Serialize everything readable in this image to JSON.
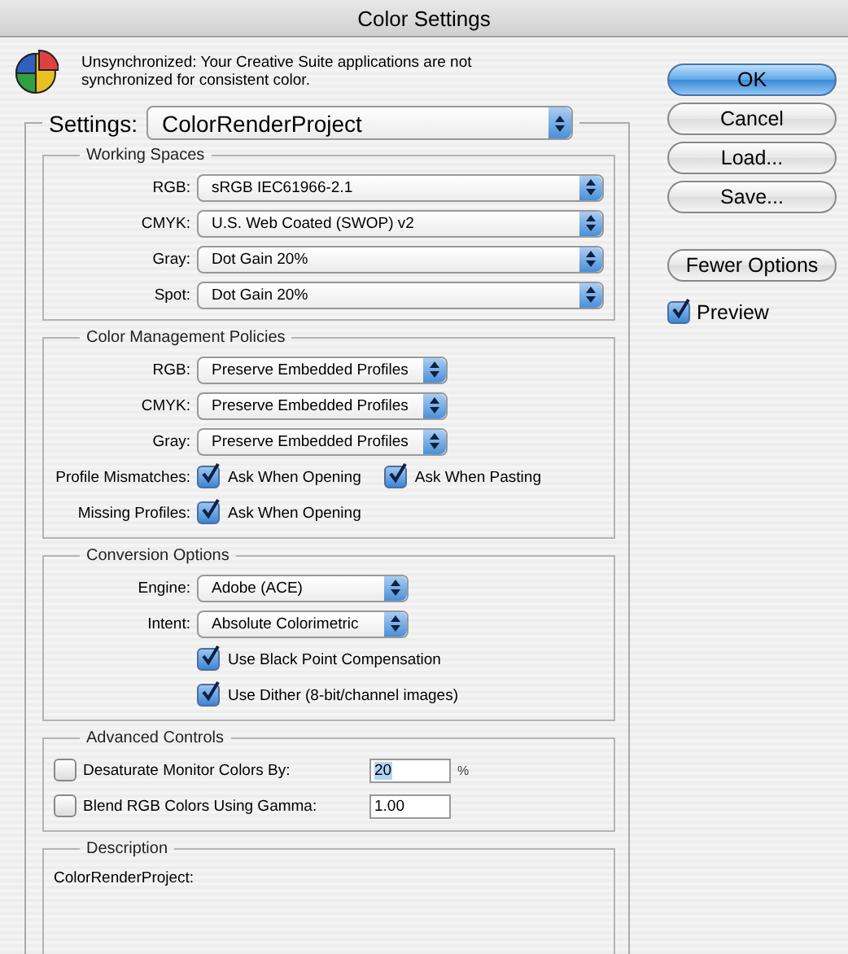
{
  "window": {
    "title": "Color Settings"
  },
  "message": "Unsynchronized: Your Creative Suite applications are not synchronized for consistent color.",
  "settings": {
    "label": "Settings:",
    "value": "ColorRenderProject"
  },
  "sections": [
    {
      "title": "Working Spaces",
      "rows": [
        {
          "kind": "select",
          "label": "RGB:",
          "value": "sRGB IEC61966-2.1"
        },
        {
          "kind": "select",
          "label": "CMYK:",
          "value": "U.S. Web Coated (SWOP) v2"
        },
        {
          "kind": "select",
          "label": "Gray:",
          "value": "Dot Gain 20%"
        },
        {
          "kind": "select",
          "label": "Spot:",
          "value": "Dot Gain 20%"
        }
      ]
    },
    {
      "title": "Color Management Policies",
      "rows": [
        {
          "kind": "select",
          "label": "RGB:",
          "value": "Preserve Embedded Profiles"
        },
        {
          "kind": "select",
          "label": "CMYK:",
          "value": "Preserve Embedded Profiles"
        },
        {
          "kind": "select",
          "label": "Gray:",
          "value": "Preserve Embedded Profiles"
        },
        {
          "kind": "checks",
          "label": "Profile Mismatches:",
          "options": [
            {
              "label": "Ask When Opening",
              "checked": true
            },
            {
              "label": "Ask When Pasting",
              "checked": true
            }
          ]
        },
        {
          "kind": "checks",
          "label": "Missing Profiles:",
          "options": [
            {
              "label": "Ask When Opening",
              "checked": true
            }
          ]
        }
      ]
    },
    {
      "title": "Conversion Options",
      "rows": [
        {
          "kind": "select",
          "label": "Engine:",
          "value": "Adobe (ACE)"
        },
        {
          "kind": "select",
          "label": "Intent:",
          "value": "Absolute Colorimetric"
        },
        {
          "kind": "checks",
          "options": [
            {
              "label": "Use Black Point Compensation",
              "checked": true
            }
          ]
        },
        {
          "kind": "checks",
          "options": [
            {
              "label": "Use Dither (8-bit/channel images)",
              "checked": true
            }
          ]
        }
      ]
    },
    {
      "title": "Advanced Controls",
      "rows": [
        {
          "kind": "field",
          "label": "Desaturate Monitor Colors By:",
          "checked": false,
          "value": "20",
          "highlighted": true,
          "unit": "%"
        },
        {
          "kind": "field",
          "label": "Blend RGB Colors Using Gamma:",
          "checked": false,
          "value": "1.00",
          "highlighted": false
        }
      ]
    },
    {
      "title": "Description",
      "rows": [
        {
          "kind": "text",
          "text": "ColorRenderProject:"
        }
      ]
    }
  ],
  "buttons": [
    {
      "label": "OK",
      "default": true
    },
    {
      "label": "Cancel",
      "default": false
    },
    {
      "label": "Load...",
      "default": false
    },
    {
      "label": "Save...",
      "default": false
    },
    {
      "label": "Fewer Options",
      "default": false
    }
  ],
  "preview": {
    "label": "Preview",
    "checked": true
  }
}
